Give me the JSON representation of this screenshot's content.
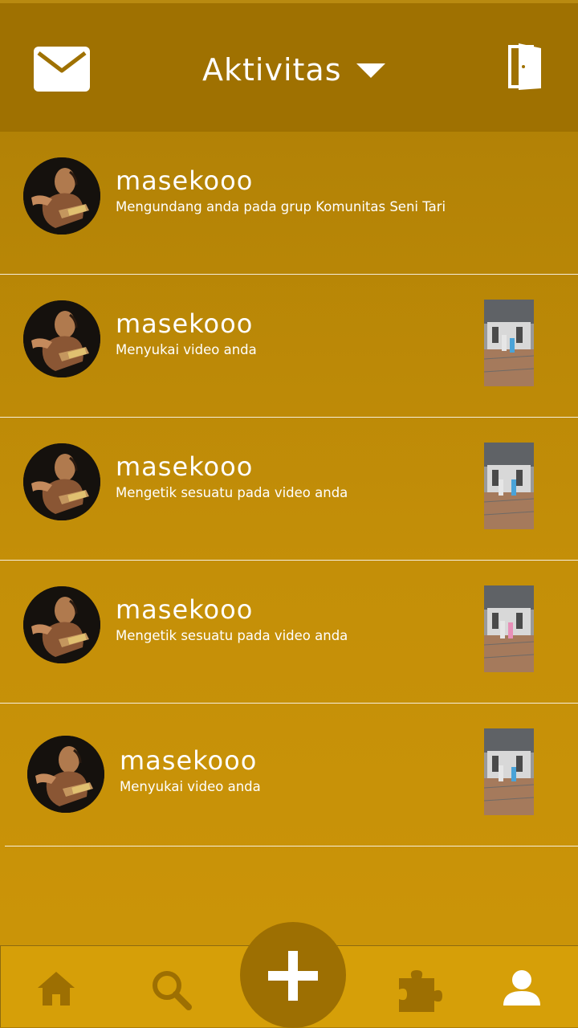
{
  "header": {
    "title": "Aktivitas",
    "mail_icon": "mail-icon",
    "dropdown_icon": "caret-down-icon",
    "exit_icon": "door-exit-icon"
  },
  "activities": [
    {
      "username": "masekooo",
      "message": "Mengundang anda pada grup Komunitas Seni Tari",
      "has_thumbnail": false
    },
    {
      "username": "masekooo",
      "message": "Menyukai video anda",
      "has_thumbnail": true
    },
    {
      "username": "masekooo",
      "message": "Mengetik sesuatu pada video anda",
      "has_thumbnail": true
    },
    {
      "username": "masekooo",
      "message": "Mengetik sesuatu pada video anda",
      "has_thumbnail": true
    },
    {
      "username": "masekooo",
      "message": "Menyukai video anda",
      "has_thumbnail": true
    }
  ],
  "bottom_nav": {
    "items": [
      "home-icon",
      "search-icon",
      "add-icon",
      "puzzle-icon",
      "profile-icon"
    ]
  },
  "colors": {
    "header_bg": "#9f7101",
    "list_bg_top": "#ad7e05",
    "list_bg_bottom": "#cc9508",
    "nav_bg": "#d69f08",
    "nav_icon": "#9d6f02",
    "fab_bg": "#9d6f02",
    "text": "#ffffff"
  }
}
